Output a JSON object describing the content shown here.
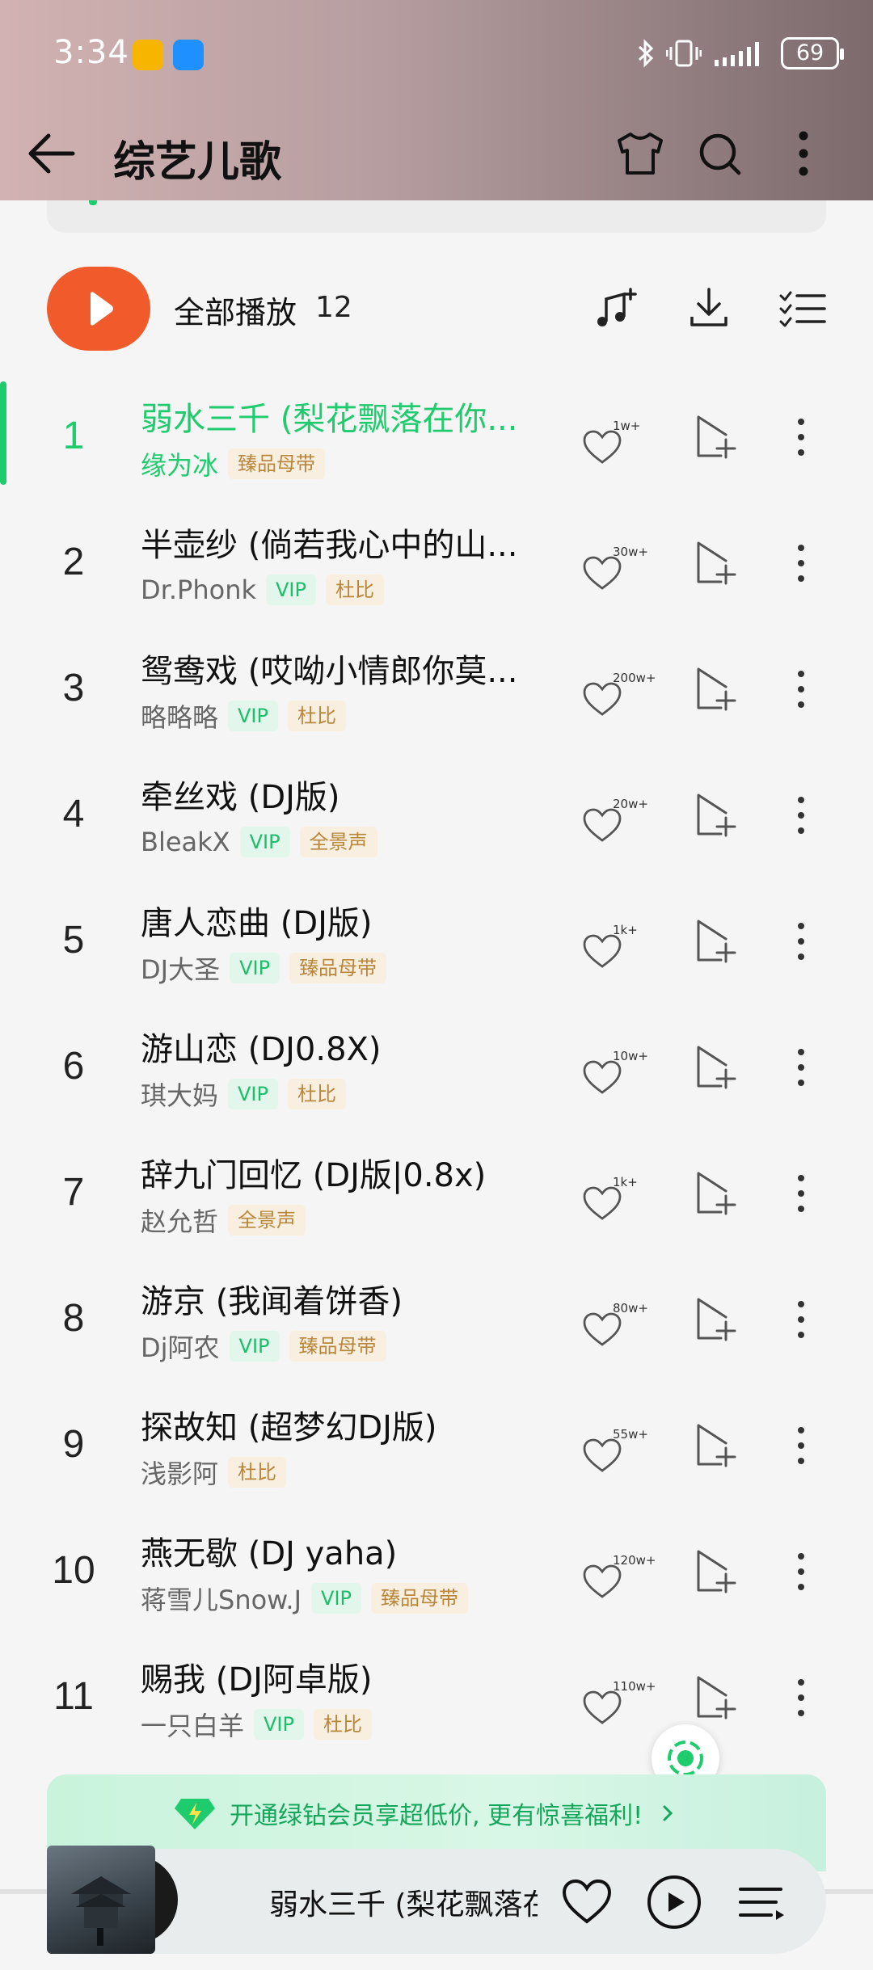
{
  "status": {
    "time": "3:34",
    "battery": "69"
  },
  "header": {
    "title": "综艺儿歌"
  },
  "play_all": {
    "label": "全部播放",
    "count": "12"
  },
  "songs": [
    {
      "index": "1",
      "title": "弱水三千 (梨花飘落在你...",
      "artist": "缘为冰",
      "vip": "",
      "tag": "臻品母带",
      "likes": "1w+",
      "active": true
    },
    {
      "index": "2",
      "title": "半壶纱 (倘若我心中的山...",
      "artist": "Dr.Phonk",
      "vip": "VIP",
      "tag": "杜比",
      "likes": "30w+"
    },
    {
      "index": "3",
      "title": "鸳鸯戏 (哎呦小情郎你莫...",
      "artist": "略略略",
      "vip": "VIP",
      "tag": "杜比",
      "likes": "200w+"
    },
    {
      "index": "4",
      "title": "牵丝戏 (DJ版)",
      "artist": "BleakX",
      "vip": "VIP",
      "tag": "全景声",
      "likes": "20w+"
    },
    {
      "index": "5",
      "title": "唐人恋曲 (DJ版)",
      "artist": "DJ大圣",
      "vip": "VIP",
      "tag": "臻品母带",
      "likes": "1k+"
    },
    {
      "index": "6",
      "title": "游山恋 (DJ0.8X)",
      "artist": "琪大妈",
      "vip": "VIP",
      "tag": "杜比",
      "likes": "10w+"
    },
    {
      "index": "7",
      "title": "辞九门回忆 (DJ版|0.8x)",
      "artist": "赵允哲",
      "vip": "",
      "tag": "全景声",
      "likes": "1k+"
    },
    {
      "index": "8",
      "title": "游京 (我闻着饼香)",
      "artist": "Dj阿农",
      "vip": "VIP",
      "tag": "臻品母带",
      "likes": "80w+"
    },
    {
      "index": "9",
      "title": "探故知 (超梦幻DJ版)",
      "artist": "浅影阿",
      "vip": "",
      "tag": "杜比",
      "likes": "55w+"
    },
    {
      "index": "10",
      "title": "燕无歇 (DJ yaha)",
      "artist": "蒋雪儿Snow.J",
      "vip": "VIP",
      "tag": "臻品母带",
      "likes": "120w+"
    },
    {
      "index": "11",
      "title": "赐我 (DJ阿卓版)",
      "artist": "一只白羊",
      "vip": "VIP",
      "tag": "杜比",
      "likes": "110w+"
    }
  ],
  "promo": {
    "text": "开通绿钻会员享超低价, 更有惊喜福利!"
  },
  "player": {
    "title": "弱水三千 (梨花飘落在你"
  },
  "colors": {
    "accent": "#1ecc6e",
    "play_button": "#f15a2b",
    "vip": "#1ebd6b",
    "tag": "#b8873c"
  },
  "icons": {
    "header": [
      "back-arrow-icon",
      "shirt-icon",
      "search-icon",
      "more-vertical-icon"
    ],
    "play_all": [
      "play-icon",
      "music-add-icon",
      "download-icon",
      "multi-select-icon"
    ],
    "row": [
      "heart-icon",
      "add-to-playlist-icon",
      "more-vertical-icon"
    ],
    "player": [
      "heart-icon",
      "play-icon",
      "playlist-icon"
    ]
  }
}
